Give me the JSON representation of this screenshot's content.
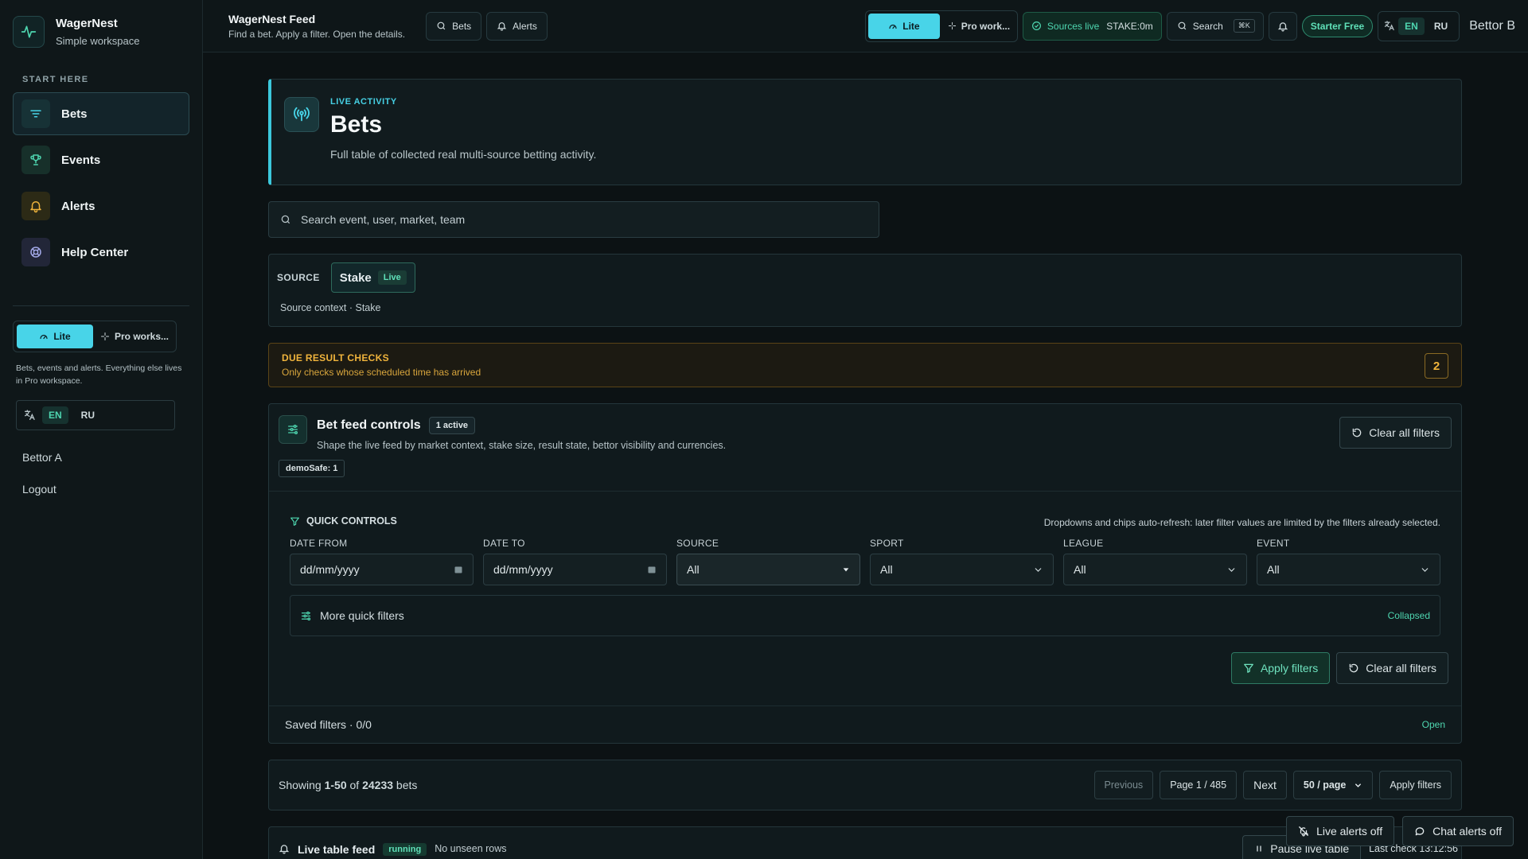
{
  "brand": {
    "name": "WagerNest",
    "subtitle": "Simple workspace"
  },
  "sidebar": {
    "section": "START HERE",
    "items": [
      {
        "label": "Bets",
        "icon": "filter-lines-icon",
        "active": true
      },
      {
        "label": "Events",
        "icon": "trophy-icon"
      },
      {
        "label": "Alerts",
        "icon": "bell-icon"
      },
      {
        "label": "Help Center",
        "icon": "lifebuoy-icon"
      }
    ],
    "mode": {
      "lite": "Lite",
      "pro": "Pro works..."
    },
    "note": "Bets, events and alerts. Everything else lives in Pro workspace.",
    "lang": {
      "en": "EN",
      "ru": "RU"
    },
    "user": "Bettor A",
    "logout": "Logout"
  },
  "topbar": {
    "title": "WagerNest Feed",
    "subtitle": "Find a bet. Apply a filter. Open the details.",
    "bets": "Bets",
    "alerts": "Alerts",
    "lite": "Lite",
    "pro": "Pro work...",
    "sources_live": "Sources live",
    "stake_status": "STAKE:0m",
    "search": "Search",
    "kbd": "⌘K",
    "plan": "Starter Free",
    "en": "EN",
    "ru": "RU",
    "user": "Bettor B"
  },
  "hero": {
    "kicker": "LIVE ACTIVITY",
    "title": "Bets",
    "desc": "Full table of collected real multi-source betting activity."
  },
  "search": {
    "placeholder": "Search event, user, market, team"
  },
  "source": {
    "label": "SOURCE",
    "chip": "Stake",
    "chip_badge": "Live",
    "context": "Source context · Stake"
  },
  "due": {
    "title": "DUE RESULT CHECKS",
    "subtitle": "Only checks whose scheduled time has arrived",
    "count": "2"
  },
  "controls": {
    "title": "Bet feed controls",
    "active_badge": "1 active",
    "desc": "Shape the live feed by market context, stake size, result state, bettor visibility and currencies.",
    "demo_badge": "demoSafe: 1",
    "clear_all": "Clear all filters",
    "quick": {
      "title": "QUICK CONTROLS",
      "hint": "Dropdowns and chips auto-refresh: later filter values are limited by the filters already selected.",
      "fields": [
        {
          "label": "DATE FROM",
          "value": "dd/mm/yyyy"
        },
        {
          "label": "DATE TO",
          "value": "dd/mm/yyyy"
        },
        {
          "label": "SOURCE",
          "value": "All"
        },
        {
          "label": "SPORT",
          "value": "All"
        },
        {
          "label": "LEAGUE",
          "value": "All"
        },
        {
          "label": "EVENT",
          "value": "All"
        }
      ],
      "more": "More quick filters",
      "collapsed": "Collapsed",
      "apply": "Apply filters",
      "clear": "Clear all filters"
    },
    "saved": "Saved filters · 0/0",
    "open": "Open"
  },
  "pager": {
    "showing": "Showing",
    "range": "1-50",
    "of": "of",
    "total": "24233",
    "unit": "bets",
    "previous": "Previous",
    "page": "Page 1 / 485",
    "next": "Next",
    "per_page": "50 / page",
    "apply": "Apply filters"
  },
  "feed": {
    "title": "Live table feed",
    "status": "running",
    "unseen": "No unseen rows",
    "pause": "Pause live table",
    "last_check": "Last check 13:12:56"
  },
  "floating": {
    "live_alerts": "Live alerts off",
    "chat_alerts": "Chat alerts off"
  },
  "colors": {
    "accent": "#48d4e8",
    "green": "#4ed6b0",
    "warning": "#f0b43c",
    "bg": "#0c1214"
  }
}
